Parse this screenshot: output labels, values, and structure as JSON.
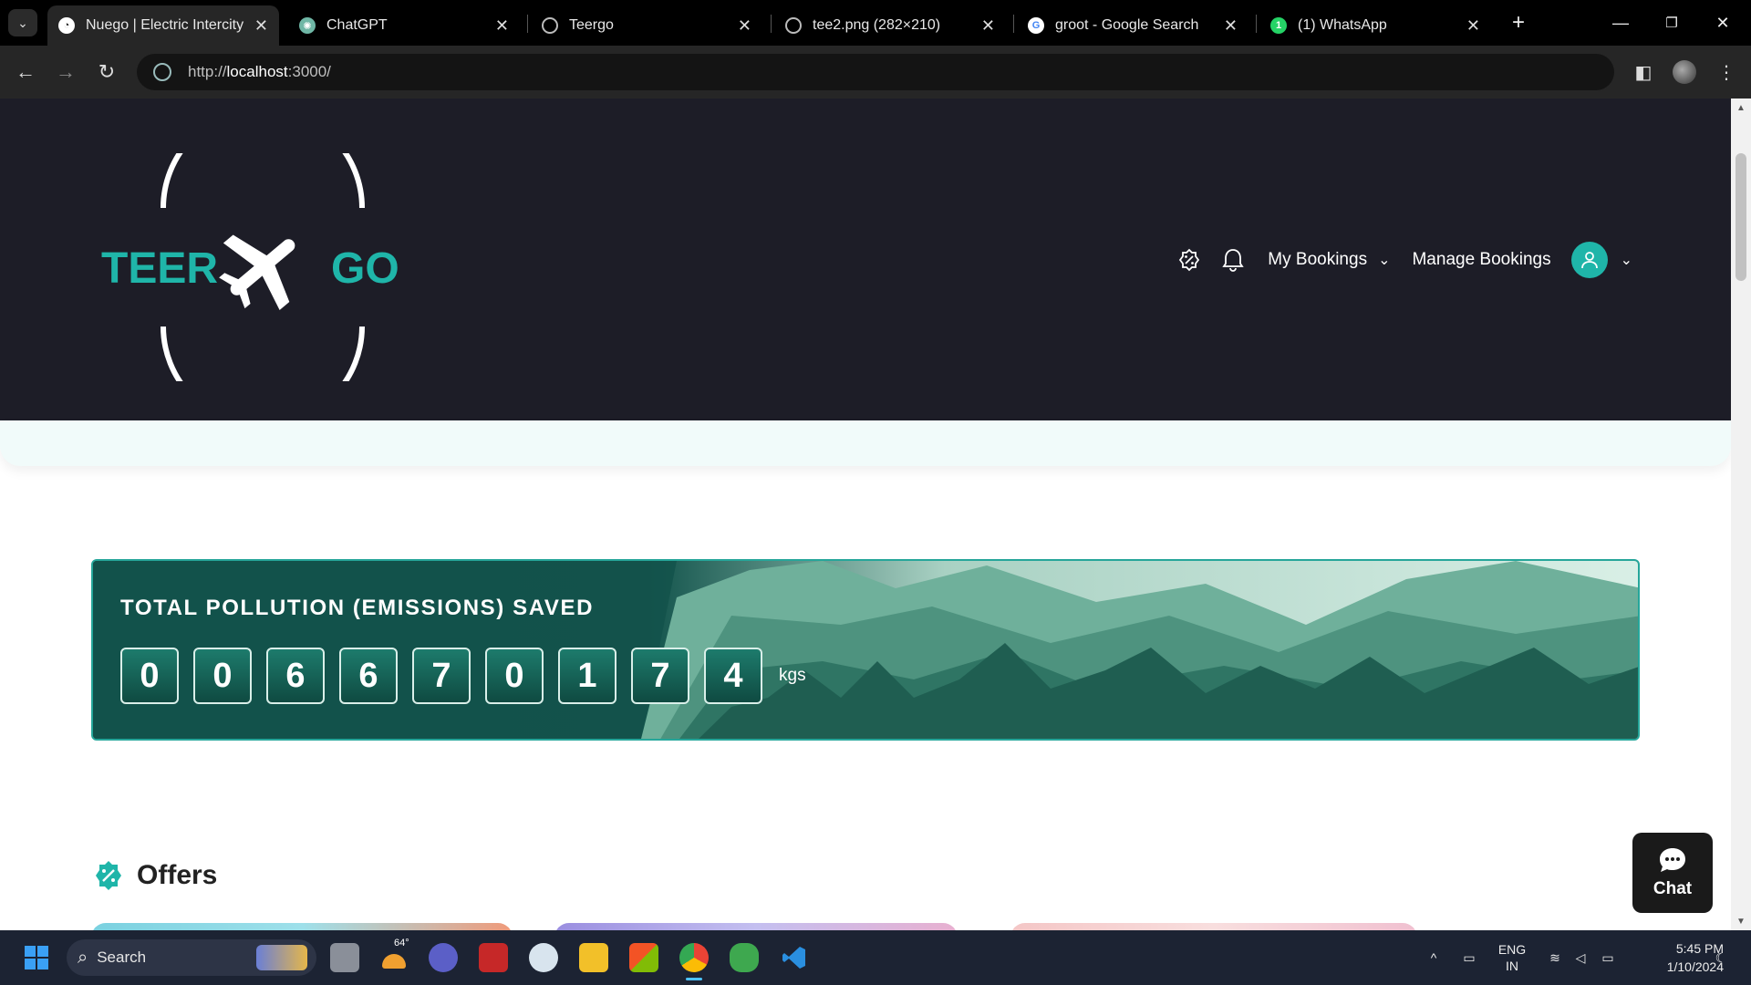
{
  "browser": {
    "tabs": [
      {
        "title": "Nuego | Electric Intercity Bus",
        "active": true
      },
      {
        "title": "ChatGPT",
        "active": false
      },
      {
        "title": "Teergo",
        "active": false
      },
      {
        "title": "tee2.png (282×210)",
        "active": false
      },
      {
        "title": "groot - Google Search",
        "active": false
      },
      {
        "title": "(1) WhatsApp",
        "active": false
      }
    ],
    "url_scheme": "http://",
    "url_host": "localhost",
    "url_rest": ":3000/"
  },
  "header": {
    "logo_left": "TEER",
    "logo_right": "GO",
    "nav": {
      "my_bookings": "My Bookings",
      "manage_bookings": "Manage Bookings"
    }
  },
  "emission": {
    "title": "TOTAL POLLUTION (EMISSIONS) SAVED",
    "digits": [
      "0",
      "0",
      "6",
      "6",
      "7",
      "0",
      "1",
      "7",
      "4"
    ],
    "unit": "kgs"
  },
  "offers": {
    "title": "Offers"
  },
  "chat": {
    "label": "Chat"
  },
  "taskbar": {
    "search_placeholder": "Search",
    "weather_temp": "64°",
    "lang_top": "ENG",
    "lang_bottom": "IN",
    "time": "5:45 PM",
    "date": "1/10/2024"
  },
  "colors": {
    "accent": "#1fb5a9",
    "header_bg": "#1d1d27",
    "emission_bg": "#14514a"
  }
}
